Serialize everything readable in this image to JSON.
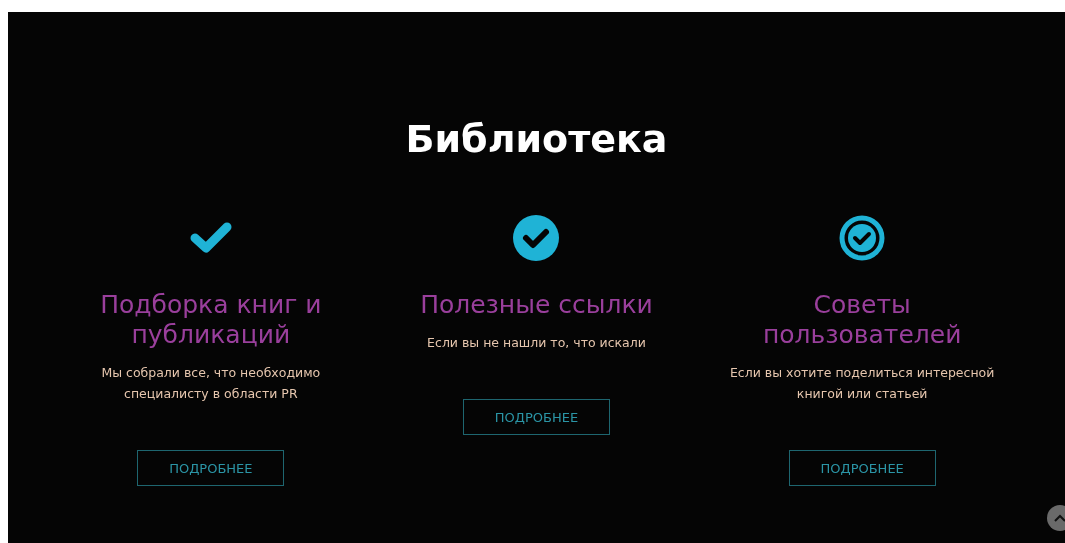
{
  "title": "Библиотека",
  "features": [
    {
      "kind": "check",
      "heading": "Подборка книг и публикаций",
      "text": "Мы собрали все, что необходимо специалисту в области PR",
      "button": "ПОДРОБНЕЕ"
    },
    {
      "kind": "check-circle-filled",
      "heading": "Полезные ссылки",
      "text": "Если вы не нашли то, что искали",
      "button": "ПОДРОБНЕЕ"
    },
    {
      "kind": "check-circle-outline",
      "heading": "Советы пользователей",
      "text": "Если вы хотите поделиться интересной книгой или статьей",
      "button": "ПОДРОБНЕЕ"
    }
  ]
}
